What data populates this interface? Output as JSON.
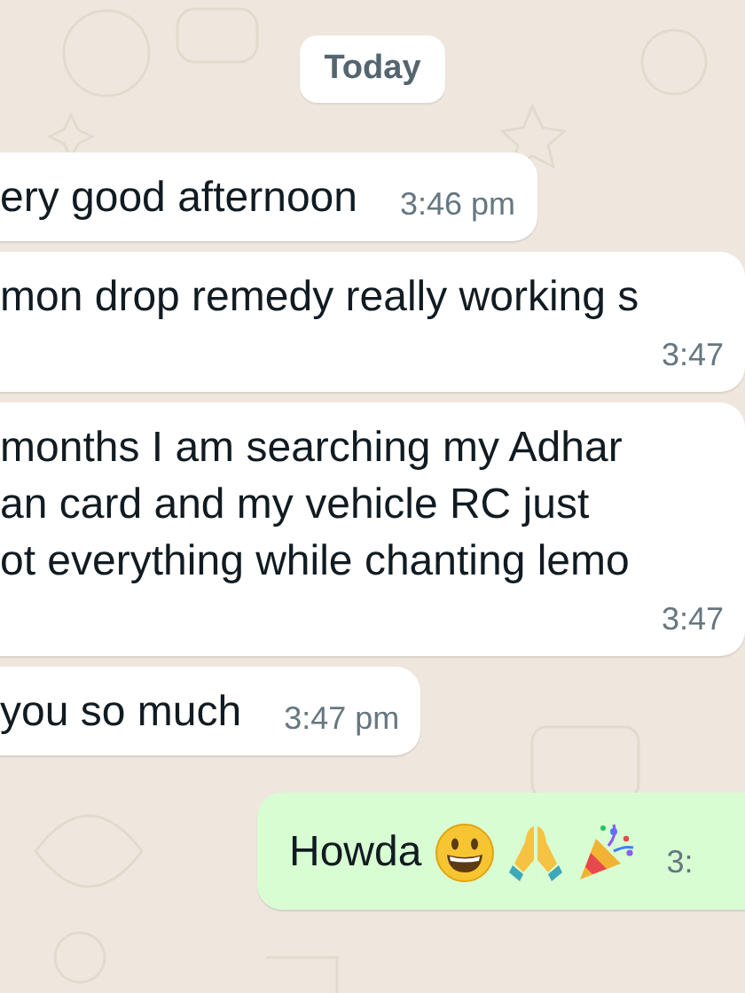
{
  "date_chip": "Today",
  "messages": [
    {
      "kind": "incoming",
      "text": "ery good afternoon",
      "time": "3:46 pm"
    },
    {
      "kind": "incoming",
      "text": "mon drop remedy really working s",
      "time": "3:47"
    },
    {
      "kind": "incoming",
      "text": "months I am searching my Adhar\nan card and my vehicle RC just\not everything while chanting lemo",
      "time": "3:47"
    },
    {
      "kind": "incoming",
      "text": "you so much",
      "time": "3:47 pm"
    },
    {
      "kind": "outgoing",
      "text": "Howda",
      "time": "3:"
    }
  ]
}
